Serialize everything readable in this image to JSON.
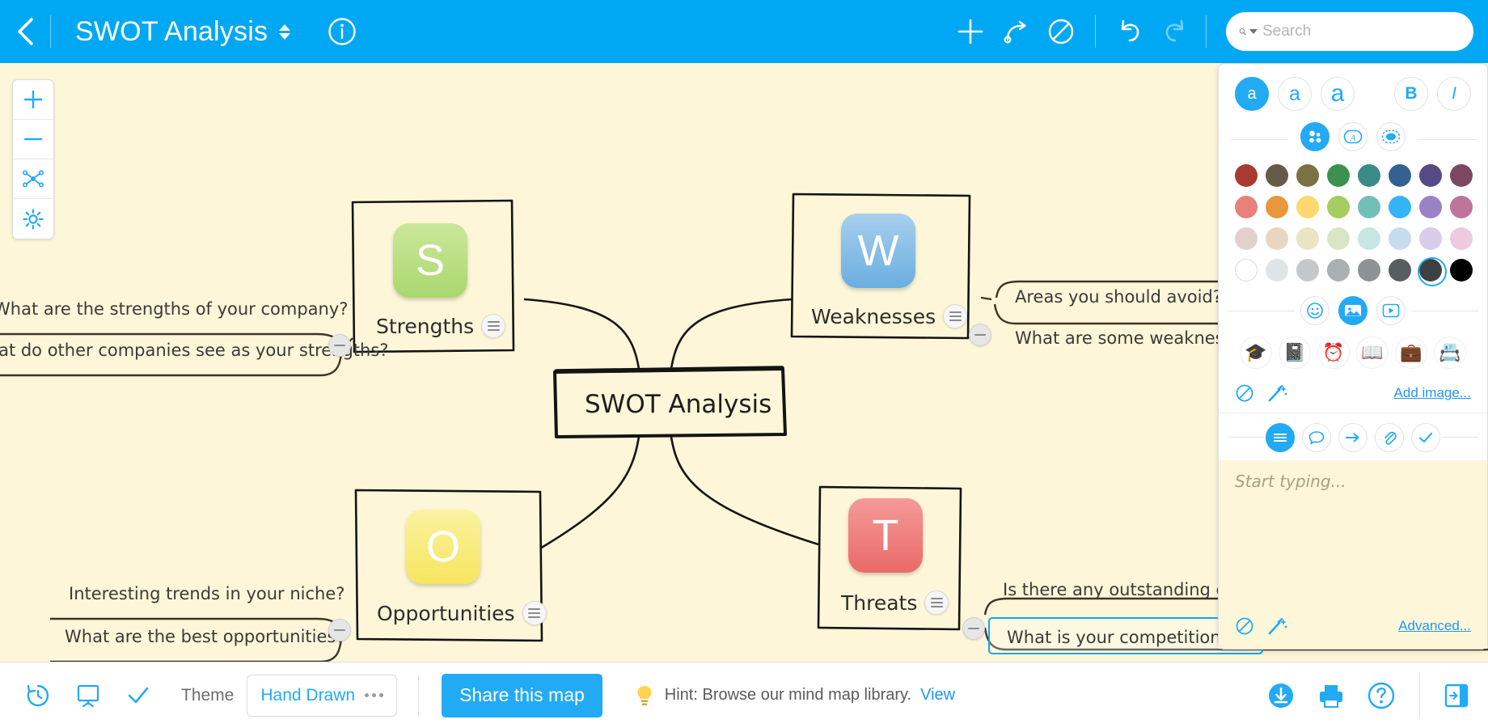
{
  "header": {
    "back_icon": "chevron-left-icon",
    "title": "SWOT Analysis",
    "sort_icon": "sort-updown-icon",
    "info_icon": "info-circle-icon",
    "tools": [
      {
        "name": "add-node-button",
        "icon": "plus-icon"
      },
      {
        "name": "add-relationship-button",
        "icon": "curved-arrow-icon"
      },
      {
        "name": "delete-button",
        "icon": "ban-circle-icon"
      },
      {
        "name": "undo-button",
        "icon": "undo-arrow-icon"
      },
      {
        "name": "redo-button",
        "icon": "redo-arrow-icon"
      }
    ],
    "search": {
      "placeholder": "Search",
      "value": "",
      "icon": "search-icon"
    }
  },
  "zoom_panel": [
    {
      "name": "zoom-in-button",
      "icon": "plus-icon"
    },
    {
      "name": "zoom-out-button",
      "icon": "minus-icon"
    },
    {
      "name": "fit-map-button",
      "icon": "fit-map-icon"
    },
    {
      "name": "map-settings-button",
      "icon": "gear-icon"
    }
  ],
  "map": {
    "central": {
      "text": "SWOT Analysis"
    },
    "branches": [
      {
        "key": "strengths",
        "letter": "S",
        "label": "Strengths",
        "color": "#a9d86e",
        "color_light": "#cbe79a",
        "leaves": [
          "What are the strengths of your company?",
          "What do other companies see as your strengths?"
        ]
      },
      {
        "key": "weaknesses",
        "letter": "W",
        "label": "Weaknesses",
        "color": "#6aaee0",
        "color_light": "#a8cfee",
        "leaves": [
          "Areas you should avoid?",
          "What are some weaknesses?"
        ]
      },
      {
        "key": "opportunities",
        "letter": "O",
        "label": "Opportunities",
        "color": "#f7e55e",
        "color_light": "#fbf2a0",
        "leaves": [
          "Interesting trends in your niche?",
          "What are the best opportunities?"
        ]
      },
      {
        "key": "threats",
        "letter": "T",
        "label": "Threats",
        "color": "#ea6a68",
        "color_light": "#f49a98",
        "leaves": [
          "Is there any outstanding debt?",
          "What is your competition doing?"
        ]
      }
    ],
    "selected_node": "What is your competition doing?"
  },
  "right_panel": {
    "font_sizes": [
      {
        "label": "a",
        "size": "small",
        "active": true
      },
      {
        "label": "a",
        "size": "medium",
        "active": false
      },
      {
        "label": "a",
        "size": "large",
        "active": false
      }
    ],
    "bold_label": "B",
    "italic_label": "I",
    "color_targets": [
      {
        "name": "fill-color-target",
        "icon": "bubbles-icon",
        "active": true
      },
      {
        "name": "text-color-target",
        "icon": "letter-a-icon",
        "active": false
      },
      {
        "name": "border-color-target",
        "icon": "border-icon",
        "active": false
      }
    ],
    "palette": [
      [
        "#a73a33",
        "#685a49",
        "#7a7241",
        "#3c9050",
        "#3a8a8a",
        "#34618f",
        "#554a86",
        "#7d4761"
      ],
      [
        "#e8817a",
        "#e8973c",
        "#fbd96e",
        "#a5cd5f",
        "#72bfba",
        "#33b5f5",
        "#9b82c4",
        "#bf749c"
      ],
      [
        "#e4cfcf",
        "#e8d6c2",
        "#e8e4c4",
        "#d9e6c6",
        "#c8e6e2",
        "#c6dcee",
        "#d8ccea",
        "#edcade"
      ],
      [
        "#ffffff",
        "#dfe4e6",
        "#c4c8ca",
        "#aaafb1",
        "#8d9294",
        "#585d60",
        "#3c4145",
        "#000000"
      ]
    ],
    "selected_swatch": {
      "row": 3,
      "col": 6
    },
    "media_tabs": [
      {
        "name": "emoji-tab",
        "icon": "smiley-icon",
        "active": false
      },
      {
        "name": "image-tab",
        "icon": "image-icon",
        "active": true
      },
      {
        "name": "video-tab",
        "icon": "video-play-icon",
        "active": false
      }
    ],
    "emoji_items": [
      {
        "name": "graduation-cap-icon",
        "glyph": "🎓"
      },
      {
        "name": "address-book-icon",
        "glyph": "📓"
      },
      {
        "name": "alarm-clock-icon",
        "glyph": "⏰"
      },
      {
        "name": "open-book-icon",
        "glyph": "📖"
      },
      {
        "name": "briefcase-icon",
        "glyph": "💼"
      },
      {
        "name": "business-card-icon",
        "glyph": "📇"
      }
    ],
    "image_clear_icon": "ban-circle-icon",
    "image_magic_icon": "magic-wand-icon",
    "add_image_label": "Add image...",
    "note_tabs": [
      {
        "name": "notes-tab",
        "icon": "lines-icon",
        "active": true
      },
      {
        "name": "comment-tab",
        "icon": "speech-bubble-icon",
        "active": false
      },
      {
        "name": "link-tab",
        "icon": "arrow-right-icon",
        "active": false
      },
      {
        "name": "attachment-tab",
        "icon": "paperclip-icon",
        "active": false
      },
      {
        "name": "task-tab",
        "icon": "check-icon",
        "active": false
      }
    ],
    "note_placeholder": "Start typing...",
    "note_value": "",
    "note_clear_icon": "ban-circle-icon",
    "note_magic_icon": "magic-wand-icon",
    "advanced_label": "Advanced..."
  },
  "footer": {
    "icons": [
      {
        "name": "history-button",
        "icon": "clock-history-icon"
      },
      {
        "name": "presentation-button",
        "icon": "presentation-icon"
      },
      {
        "name": "task-button",
        "icon": "check-icon"
      }
    ],
    "theme_label": "Theme",
    "theme_value": "Hand Drawn",
    "theme_more_icon": "ellipsis-icon",
    "share_label": "Share this map",
    "hint_icon": "lightbulb-icon",
    "hint_text": "Hint: Browse our mind map library.",
    "hint_link": "View",
    "right_icons": [
      {
        "name": "download-button",
        "icon": "download-circle-icon"
      },
      {
        "name": "print-button",
        "icon": "printer-icon"
      },
      {
        "name": "help-button",
        "icon": "question-circle-icon"
      },
      {
        "name": "expand-panel-button",
        "icon": "panel-toggle-icon"
      }
    ]
  },
  "colors": {
    "accent": "#22aaf5",
    "topbar": "#00a8f3",
    "canvas": "#fdf6d8"
  }
}
